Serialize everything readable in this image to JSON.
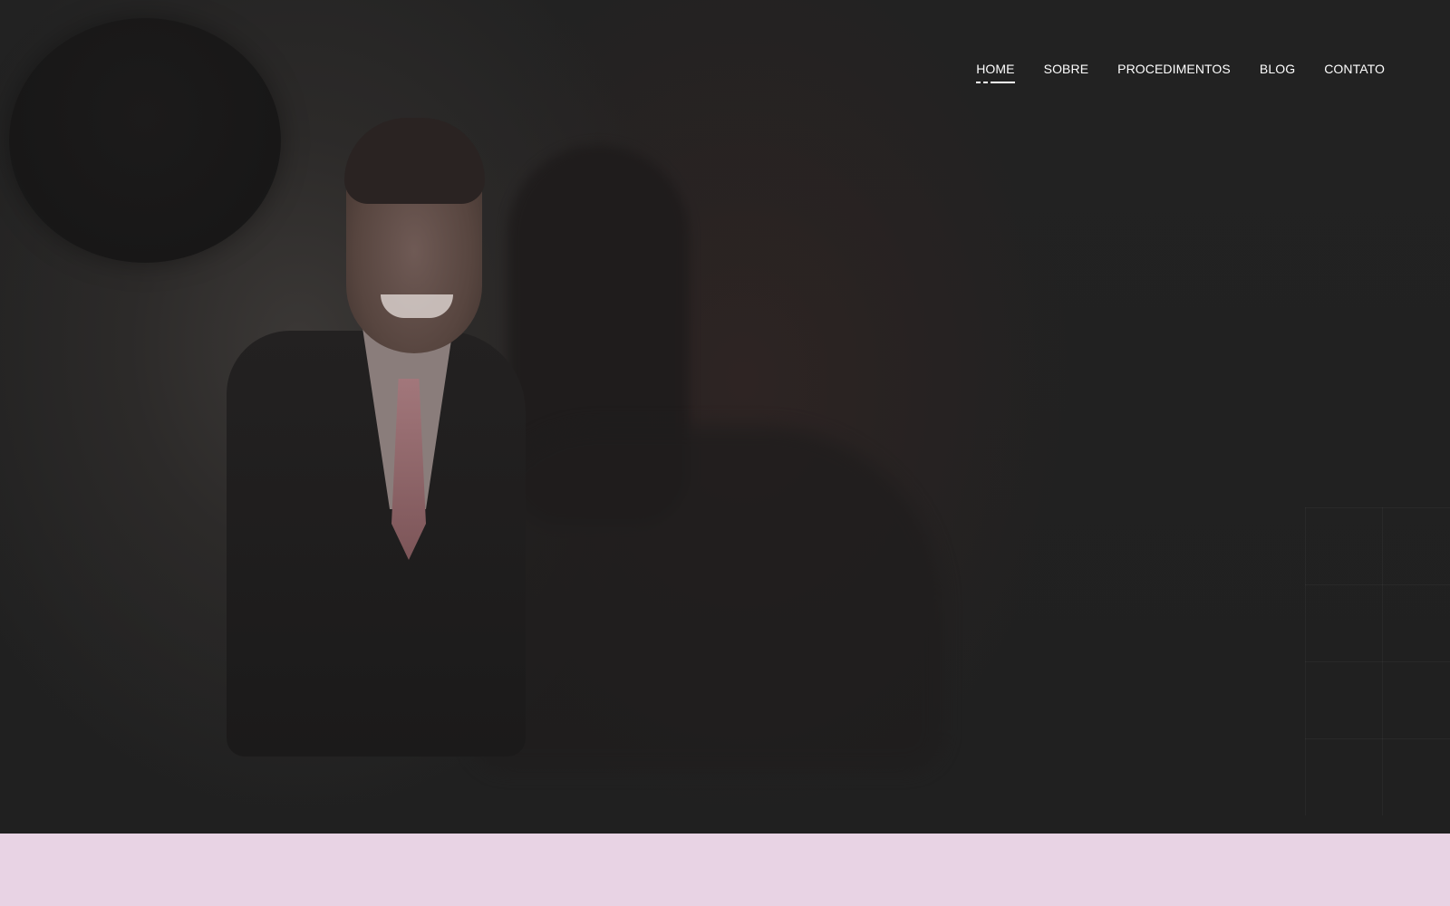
{
  "nav": {
    "items": [
      {
        "label": "HOME",
        "active": true
      },
      {
        "label": "SOBRE",
        "active": false
      },
      {
        "label": "PROCEDIMENTOS",
        "active": false
      },
      {
        "label": "BLOG",
        "active": false
      },
      {
        "label": "CONTATO",
        "active": false
      }
    ]
  },
  "colors": {
    "hero_background": "#202020",
    "nav_text": "#ffffff",
    "band_background": "#e8d3e4",
    "tie_accent": "#a2777b"
  }
}
